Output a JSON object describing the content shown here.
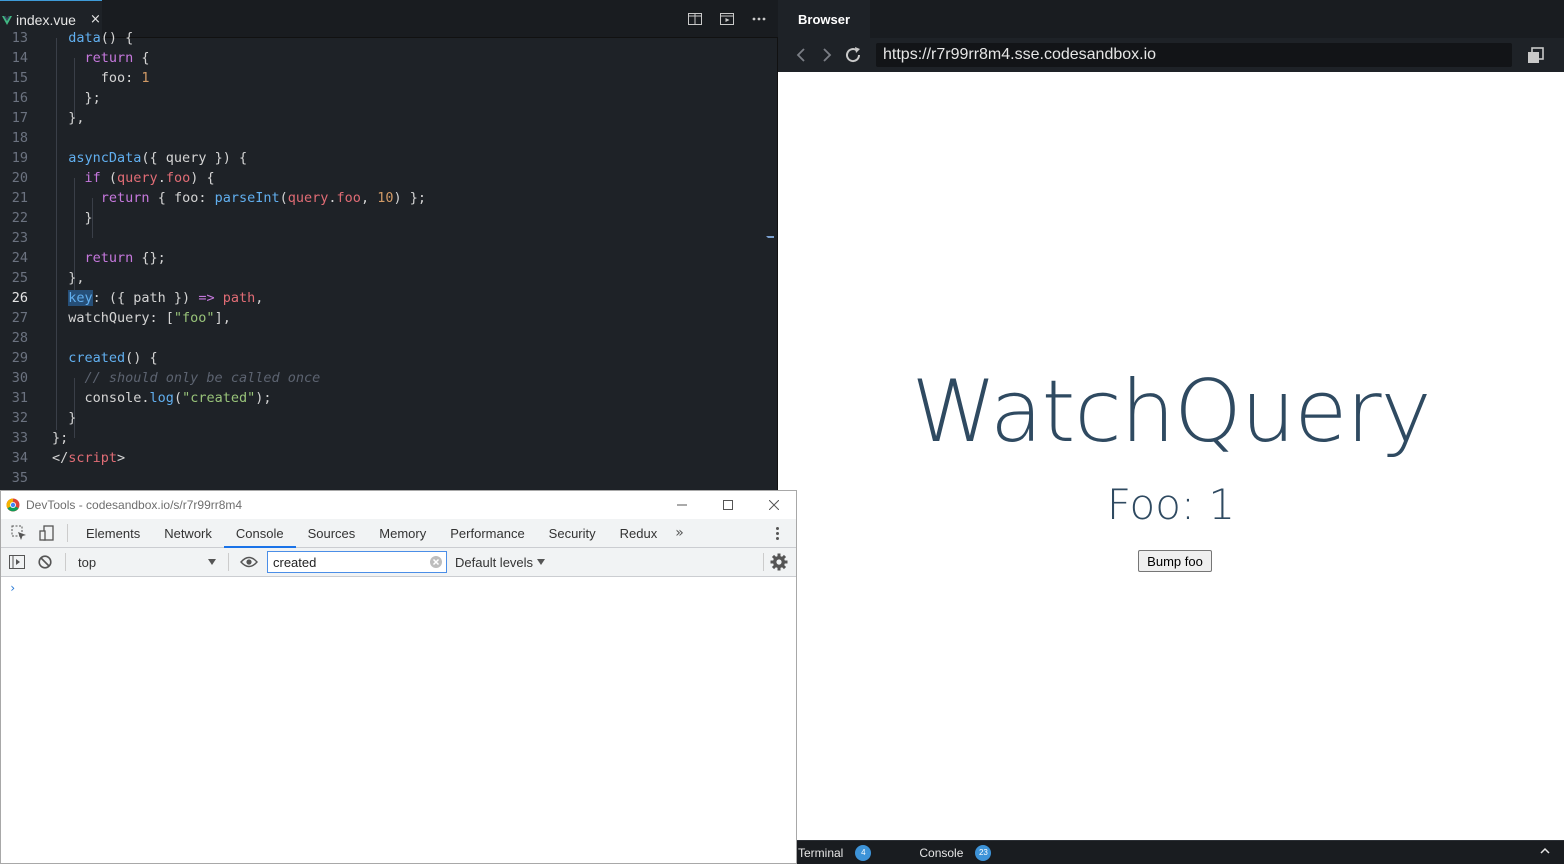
{
  "editor": {
    "tab_label": "index.vue",
    "tab_close": "×",
    "active_line": "26",
    "lines": [
      {
        "n": "13",
        "segs": [
          {
            "t": "  "
          },
          {
            "t": "data",
            "c": "tok-fn"
          },
          {
            "t": "() {"
          }
        ]
      },
      {
        "n": "14",
        "segs": [
          {
            "t": "    "
          },
          {
            "t": "return",
            "c": "tok-kw"
          },
          {
            "t": " {"
          }
        ]
      },
      {
        "n": "15",
        "segs": [
          {
            "t": "      foo: "
          },
          {
            "t": "1",
            "c": "tok-num"
          }
        ]
      },
      {
        "n": "16",
        "segs": [
          {
            "t": "    };"
          }
        ]
      },
      {
        "n": "17",
        "segs": [
          {
            "t": "  },"
          }
        ]
      },
      {
        "n": "18",
        "segs": []
      },
      {
        "n": "19",
        "segs": [
          {
            "t": "  "
          },
          {
            "t": "asyncData",
            "c": "tok-fn"
          },
          {
            "t": "({ query }) {"
          }
        ]
      },
      {
        "n": "20",
        "segs": [
          {
            "t": "    "
          },
          {
            "t": "if",
            "c": "tok-kw"
          },
          {
            "t": " ("
          },
          {
            "t": "query",
            "c": "tok-prop"
          },
          {
            "t": "."
          },
          {
            "t": "foo",
            "c": "tok-prop"
          },
          {
            "t": ") {"
          }
        ]
      },
      {
        "n": "21",
        "segs": [
          {
            "t": "      "
          },
          {
            "t": "return",
            "c": "tok-kw"
          },
          {
            "t": " { foo: "
          },
          {
            "t": "parseInt",
            "c": "tok-fn"
          },
          {
            "t": "("
          },
          {
            "t": "query",
            "c": "tok-prop"
          },
          {
            "t": "."
          },
          {
            "t": "foo",
            "c": "tok-prop"
          },
          {
            "t": ", "
          },
          {
            "t": "10",
            "c": "tok-num"
          },
          {
            "t": ") };"
          }
        ]
      },
      {
        "n": "22",
        "segs": [
          {
            "t": "    }"
          }
        ]
      },
      {
        "n": "23",
        "segs": []
      },
      {
        "n": "24",
        "segs": [
          {
            "t": "    "
          },
          {
            "t": "return",
            "c": "tok-kw"
          },
          {
            "t": " {};"
          }
        ]
      },
      {
        "n": "25",
        "segs": [
          {
            "t": "  },"
          }
        ]
      },
      {
        "n": "26",
        "segs": [
          {
            "t": "  "
          },
          {
            "t": "key",
            "c": "tok-sel tok-fn"
          },
          {
            "t": ": ({ path }) "
          },
          {
            "t": "=>",
            "c": "tok-kw"
          },
          {
            "t": " "
          },
          {
            "t": "path",
            "c": "tok-prop"
          },
          {
            "t": ","
          }
        ]
      },
      {
        "n": "27",
        "segs": [
          {
            "t": "  watchQuery: ["
          },
          {
            "t": "\"foo\"",
            "c": "tok-str"
          },
          {
            "t": "],"
          }
        ]
      },
      {
        "n": "28",
        "segs": []
      },
      {
        "n": "29",
        "segs": [
          {
            "t": "  "
          },
          {
            "t": "created",
            "c": "tok-fn"
          },
          {
            "t": "() {"
          }
        ]
      },
      {
        "n": "30",
        "segs": [
          {
            "t": "    "
          },
          {
            "t": "// should only be called once",
            "c": "tok-com"
          }
        ]
      },
      {
        "n": "31",
        "segs": [
          {
            "t": "    console."
          },
          {
            "t": "log",
            "c": "tok-fn"
          },
          {
            "t": "("
          },
          {
            "t": "\"created\"",
            "c": "tok-str"
          },
          {
            "t": ");"
          }
        ]
      },
      {
        "n": "32",
        "segs": [
          {
            "t": "  }"
          }
        ]
      },
      {
        "n": "33",
        "segs": [
          {
            "t": "};"
          }
        ]
      },
      {
        "n": "34",
        "segs": [
          {
            "t": "</"
          },
          {
            "t": "script",
            "c": "tok-prop"
          },
          {
            "t": ">"
          }
        ]
      },
      {
        "n": "35",
        "segs": []
      }
    ]
  },
  "browser": {
    "tab_label": "Browser",
    "url": "https://r7r99rr8m4.sse.codesandbox.io",
    "heading": "WatchQuery",
    "foo_readout": "Foo: 1",
    "bump_label": "Bump foo"
  },
  "bottombar": {
    "terminal_label": "Terminal",
    "terminal_count": "4",
    "console_label": "Console",
    "console_count": "23"
  },
  "devtools": {
    "title": "DevTools - codesandbox.io/s/r7r99rr8m4",
    "tabs": [
      "Elements",
      "Network",
      "Console",
      "Sources",
      "Memory",
      "Performance",
      "Security",
      "Redux"
    ],
    "active_tab": "Console",
    "more_tabs": "»",
    "context": "top",
    "filter_value": "created",
    "levels": "Default levels",
    "prompt": "›"
  },
  "colors": {
    "accent": "#1a73e8",
    "heading": "#2f4a61",
    "badge": "#3d93d8"
  }
}
